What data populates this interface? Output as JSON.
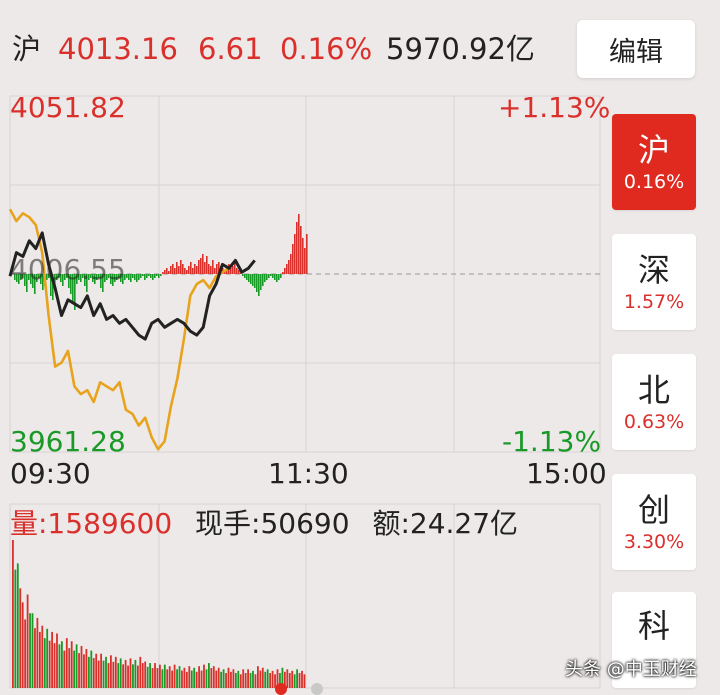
{
  "header": {
    "market": "沪",
    "price": "4013.16",
    "change": "6.61",
    "change_pct": "0.16%",
    "turnover": "5970.92亿",
    "edit_label": "编辑"
  },
  "chart": {
    "y_max": "4051.82",
    "y_min": "3961.28",
    "y_mid": "4006.55",
    "pct_max": "+1.13%",
    "pct_min": "-1.13%",
    "x_ticks": [
      "09:30",
      "11:30",
      "15:00"
    ]
  },
  "volume": {
    "volume_label": "量:1589600",
    "current_hand": "现手:50690",
    "amount": "额:24.27亿"
  },
  "side_tabs": [
    {
      "name": "沪",
      "pct": "0.16%",
      "active": true
    },
    {
      "name": "深",
      "pct": "1.57%",
      "active": false
    },
    {
      "name": "北",
      "pct": "0.63%",
      "active": false
    },
    {
      "name": "创",
      "pct": "3.30%",
      "active": false
    },
    {
      "name": "科",
      "pct": "",
      "active": false
    }
  ],
  "watermark": "头条 @中玉财经",
  "colors": {
    "up": "#d9302c",
    "down": "#199927",
    "avg_line": "#e8a31d",
    "price_line": "#222222",
    "active_tab": "#e0291f"
  },
  "chart_data": {
    "type": "line",
    "x_range": [
      "09:30",
      "15:00"
    ],
    "ylim": [
      3961.28,
      4051.82
    ],
    "prev_close": 4006.55,
    "series": [
      {
        "values": [
          4006,
          4012,
          4011,
          4015,
          4013,
          4017,
          4009,
          4003,
          3996,
          4000,
          3999,
          3998,
          4001,
          3996,
          3999,
          3995,
          3996,
          3994,
          3995,
          3993,
          3991,
          3990,
          3994,
          3995,
          3993,
          3994,
          3995,
          3994,
          3992,
          3991,
          3993,
          4001,
          4004,
          4009,
          4008,
          4010,
          4007,
          4008,
          4010
        ]
      },
      {
        "values": [
          4023,
          4020,
          4022,
          4021,
          4019,
          4012,
          3996,
          3983,
          3984,
          3987,
          3978,
          3976,
          3977,
          3974,
          3979,
          3978,
          3977,
          3979,
          3972,
          3971,
          3968,
          3970,
          3965,
          3962,
          3964,
          3973,
          3980,
          3990,
          4001,
          4004,
          4005,
          4003,
          4006,
          4007,
          4008
        ]
      }
    ],
    "volume_values": [
      95,
      80,
      55,
      60,
      48,
      45,
      40,
      38,
      36,
      35,
      30,
      32,
      30,
      28,
      27,
      25,
      24,
      22,
      22,
      20,
      21,
      20,
      19,
      18,
      19,
      18,
      20,
      17,
      16,
      16,
      15,
      15,
      14,
      15,
      14,
      13,
      14,
      13,
      14,
      15,
      16,
      14,
      13,
      12,
      13,
      12,
      11,
      12,
      12,
      11,
      14,
      13,
      12,
      11,
      12,
      13,
      12,
      11,
      12,
      11
    ]
  }
}
